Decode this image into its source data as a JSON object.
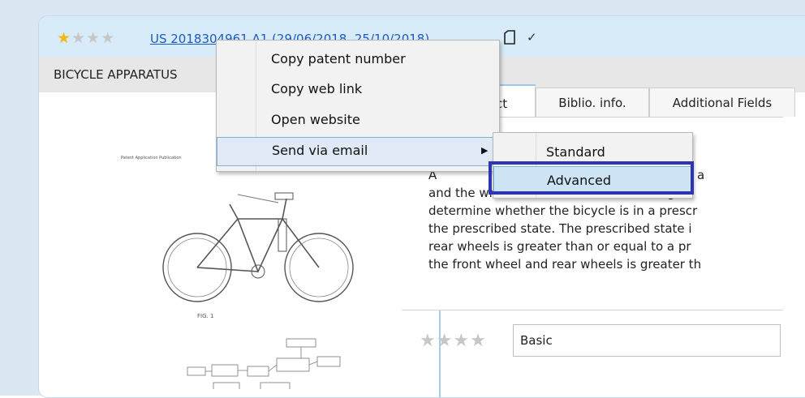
{
  "header": {
    "rating_filled": "★",
    "rating_empty": "★★★",
    "patent_link": "US 2018304961 A1 (29/06/2018, 25/10/2018)",
    "copy_icon": "document-icon",
    "check_icon": "✓",
    "title": "BICYCLE APPARATUS"
  },
  "tabs": [
    {
      "label": "act"
    },
    {
      "label": "Biblio. info."
    },
    {
      "label": "Additional Fields"
    }
  ],
  "abstract": {
    "lines": [
      "A                                               an ABS unit, a",
      "and the wheel detection device is configu",
      "determine whether the bicycle is in a prescr",
      "the prescribed state. The prescribed state i",
      "rear wheels is greater than or equal to a pr",
      "the front wheel and rear wheels is greater th"
    ]
  },
  "bottom": {
    "rating": "★★★★",
    "classification": "Basic"
  },
  "context_menu": {
    "items": [
      {
        "label": "Copy patent number"
      },
      {
        "label": "Copy web link"
      },
      {
        "label": "Open website"
      },
      {
        "label": "Send via email",
        "has_submenu": true
      }
    ],
    "submenu_arrow": "▶"
  },
  "submenu": {
    "items": [
      {
        "label": "Standard"
      },
      {
        "label": "Advanced"
      }
    ]
  },
  "colors": {
    "accent": "#2d35b5",
    "star": "#f1b81a",
    "link": "#1f5bbf"
  }
}
